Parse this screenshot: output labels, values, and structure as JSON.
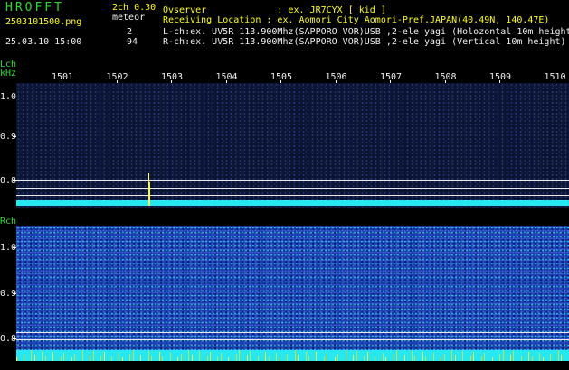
{
  "header": {
    "logo": "HROFFT",
    "version": "2ch 0.30",
    "mode": "meteor",
    "filename": "2503101500.png",
    "datetime": "25.03.10 15:00",
    "count_l": "2",
    "count_r": "94",
    "observer": "Ovserver             : ex. JR7CYX [ kid ]",
    "location": "Receiving Location : ex. Aomori City Aomori-Pref.JAPAN(40.49N, 140.47E)",
    "lch_info": "L-ch:ex. UV5R 113.900Mhz(SAPPORO VOR)USB ,2-ele yagi (Holozontal 10m height",
    "rch_info": "R-ch:ex. UV5R 113.900Mhz(SAPPORO VOR)USB ,2-ele yagi (Vertical 10m height)"
  },
  "axes": {
    "lch_label": "Lch",
    "unit": "kHz",
    "rch_label": "Rch",
    "x_ticks": [
      "1501",
      "1502",
      "1503",
      "1504",
      "1505",
      "1506",
      "1507",
      "1508",
      "1509",
      "1510"
    ],
    "y_ticks": [
      "1.0",
      "0.9",
      "0.8"
    ]
  },
  "colors": {
    "logo": "#2bd92b",
    "text": "#f0f0f0",
    "cyan": "#26e8f0",
    "yellow": "#ffff00"
  }
}
